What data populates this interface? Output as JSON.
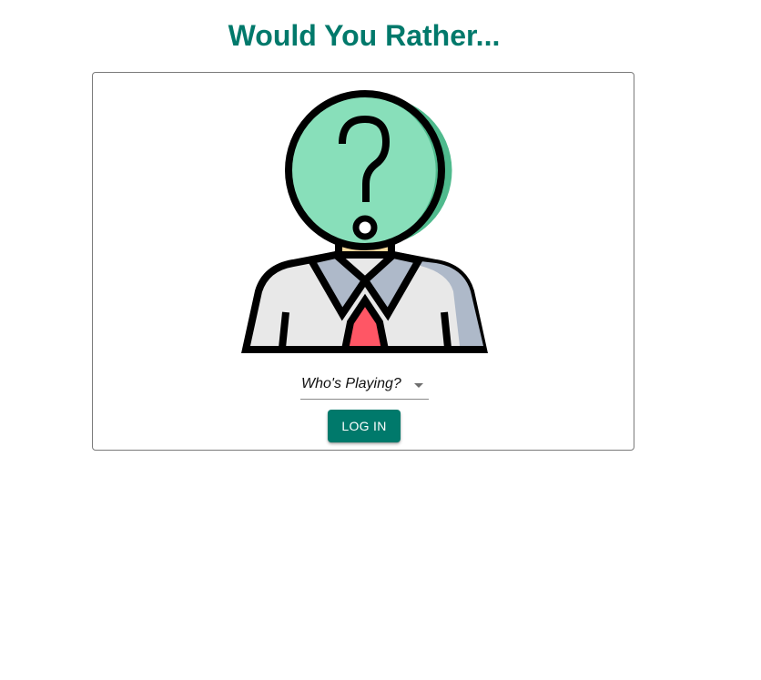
{
  "app": {
    "title": "Would You Rather..."
  },
  "login": {
    "avatar_icon": "unknown-user-icon",
    "user_select": {
      "value": "Who's Playing?"
    },
    "login_button_label": "LOG IN"
  },
  "colors": {
    "primary": "#00796b",
    "avatar_face": "#88dfba",
    "avatar_face_shadow": "#4fba8d",
    "tie": "#ff5665",
    "collar": "#aeb9c9",
    "neck": "#f8da9d",
    "shirt": "#e8e8e8"
  }
}
